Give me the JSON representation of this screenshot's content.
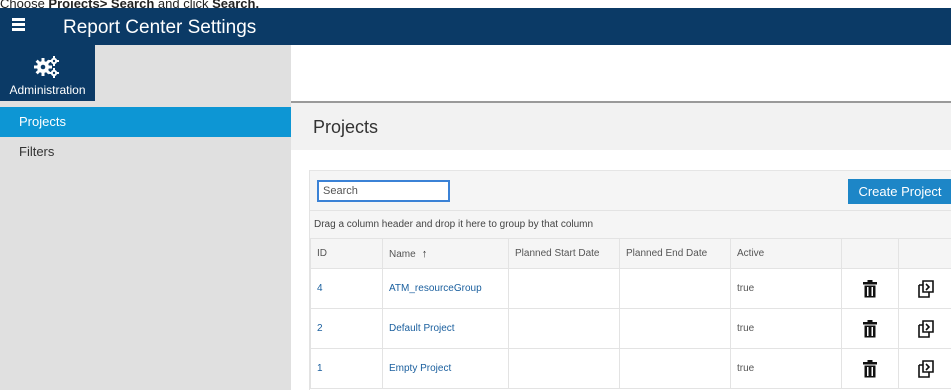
{
  "caption": {
    "prefix": "Choose ",
    "bold1": "Projects> Search",
    "middle": " and click ",
    "bold2": "Search."
  },
  "app": {
    "title": "Report Center Settings"
  },
  "admin_tile": {
    "label": "Administration",
    "icon": "gears-icon"
  },
  "sidebar": {
    "items": [
      {
        "label": "Projects",
        "active": true
      },
      {
        "label": "Filters",
        "active": false
      }
    ]
  },
  "page": {
    "heading": "Projects"
  },
  "search": {
    "placeholder": "Search",
    "value": ""
  },
  "create_button": {
    "label": "Create Project"
  },
  "group_hint": "Drag a column header and drop it here to group by that column",
  "table": {
    "columns": [
      "ID",
      "Name",
      "Planned Start Date",
      "Planned End Date",
      "Active",
      "",
      ""
    ],
    "sort": {
      "column": "Name",
      "direction": "ascending",
      "indicator": "↑"
    },
    "rows": [
      {
        "id": "4",
        "name": "ATM_resourceGroup",
        "start": "",
        "end": "",
        "active": "true"
      },
      {
        "id": "2",
        "name": "Default Project",
        "start": "",
        "end": "",
        "active": "true"
      },
      {
        "id": "1",
        "name": "Empty Project",
        "start": "",
        "end": "",
        "active": "true"
      }
    ],
    "row_actions": [
      "trash-icon",
      "copy-icon"
    ]
  },
  "colors": {
    "topbar": "#0b3a66",
    "active_sidebar": "#0d96d4",
    "button": "#1d86c7",
    "search_border": "#3b82d6",
    "link": "#1a5f9e"
  }
}
